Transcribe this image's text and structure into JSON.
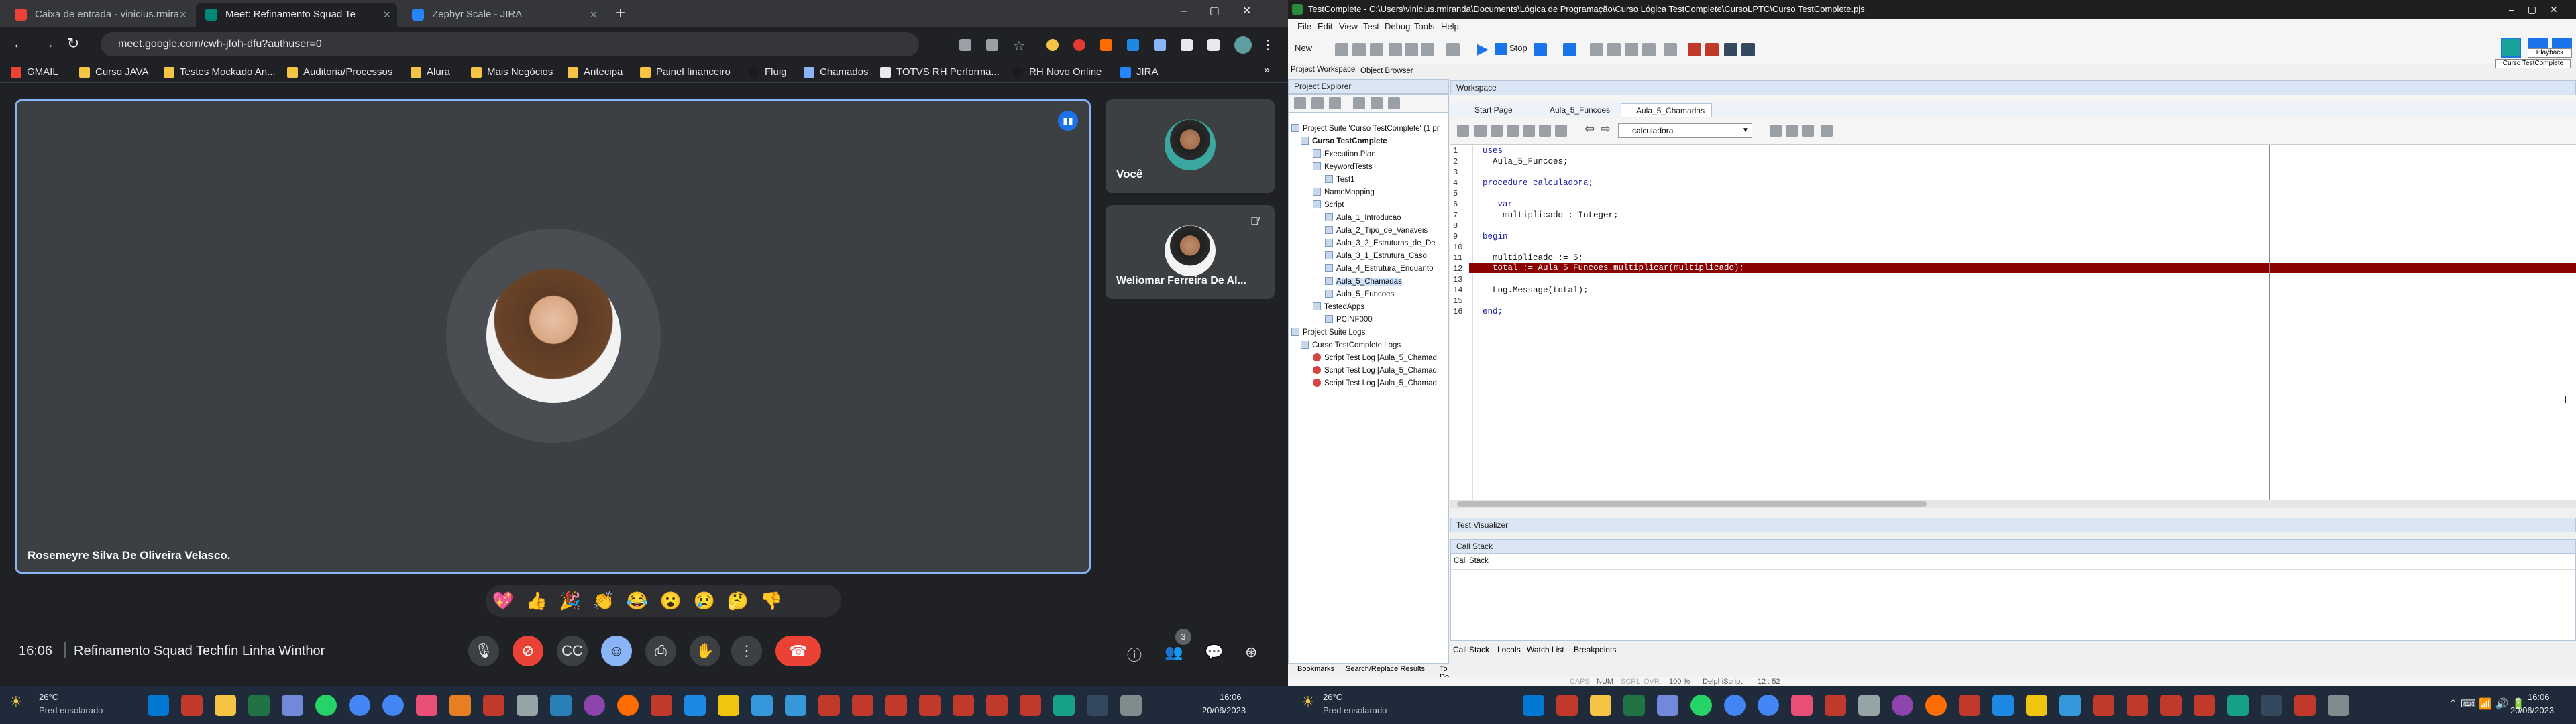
{
  "browser": {
    "tabs": [
      {
        "label": "Caixa de entrada - vinicius.rmira",
        "fav_color": "#ea4335",
        "active": false
      },
      {
        "label": "Meet: Refinamento Squad Te",
        "fav_color": "#00897b",
        "active": true
      },
      {
        "label": "Zephyr Scale - JIRA",
        "fav_color": "#2684ff",
        "active": false
      }
    ],
    "url": "meet.google.com/cwh-jfoh-dfu?authuser=0",
    "bookmarks": [
      "GMAIL",
      "Curso JAVA",
      "Testes Mockado An...",
      "Auditoria/Processos",
      "Alura",
      "Mais Negócios",
      "Antecipa",
      "Painel financeiro",
      "Fluig",
      "Chamados",
      "TOTVS RH Performa...",
      "RH Novo Online",
      "JIRA"
    ]
  },
  "meet": {
    "main_participant": "Rosemeyre Silva De Oliveira Velasco.",
    "self_label": "Você",
    "other_participant": "Weliomar Ferreira De Al...",
    "time": "16:06",
    "meeting_name": "Refinamento Squad Techfin Linha Winthor",
    "participants_count": "3",
    "reactions": [
      "💖",
      "👍",
      "🎉",
      "👏",
      "😂",
      "😮",
      "😢",
      "🤔",
      "👎"
    ]
  },
  "testcomplete": {
    "title": "TestComplete - C:\\Users\\vinicius.rmiranda\\Documents\\Lógica de Programação\\Curso Lógica TestComplete\\CursoLPTC\\Curso TestComplete.pjs",
    "menu": [
      "File",
      "Edit",
      "View",
      "Test",
      "Debug",
      "Tools",
      "Help"
    ],
    "new_label": "New",
    "stop_label": "Stop",
    "playback_tip": "Playback",
    "curso_tip": "Curso TestComplete",
    "left_tabs": [
      "Project Workspace",
      "Object Browser"
    ],
    "explorer_title": "Project Explorer",
    "tree": [
      "Project Suite 'Curso TestComplete' (1 pr",
      "Curso TestComplete",
      "Execution Plan",
      "KeywordTests",
      "Test1",
      "NameMapping",
      "Script",
      "Aula_1_Introducao",
      "Aula_2_Tipo_de_Variaveis",
      "Aula_3_2_Estruturas_de_De",
      "Aula_3_1_Estrutura_Caso",
      "Aula_4_Estrutura_Enquanto",
      "Aula_5_Chamadas",
      "Aula_5_Funcoes",
      "TestedApps",
      "PCINF000",
      "Project Suite Logs",
      "Curso TestComplete Logs",
      "Script Test Log [Aula_5_Chamad",
      "Script Test Log [Aula_5_Chamad",
      "Script Test Log [Aula_5_Chamad"
    ],
    "workspace_title": "Workspace",
    "doc_tabs": [
      "Start Page",
      "Aula_5_Funcoes",
      "Aula_5_Chamadas"
    ],
    "routine": "calculadora",
    "code_lines": [
      "uses",
      "  Aula_5_Funcoes;",
      "",
      "procedure calculadora;",
      "",
      "   var",
      "    multiplicado : Integer;",
      "",
      "begin",
      "",
      "  multiplicado := 5;",
      "  total := Aula_5_Funcoes.multiplicar(multiplicado);",
      "",
      "  Log.Message(total);",
      "",
      "end;"
    ],
    "line_numbers": [
      "1",
      "2",
      "3",
      "4",
      "5",
      "6",
      "7",
      "8",
      "9",
      "10",
      "11",
      "12",
      "13",
      "14",
      "15",
      "16"
    ],
    "visualizer": "Test Visualizer",
    "call_stack_title": "Call Stack",
    "call_stack_header": "Call Stack",
    "bottom_tabs": [
      "Call Stack",
      "Locals",
      "Watch List",
      "Breakpoints"
    ],
    "left_bottom_tabs": [
      "Bookmarks",
      "Search/Replace Results",
      "To Do"
    ],
    "status": [
      "CAPS",
      "NUM",
      "SCRL",
      "OVR",
      "100 %",
      "DelphiScript",
      "12 : 52"
    ]
  },
  "taskbar": {
    "weather_temp": "26°C",
    "weather_desc": "Pred ensolarado",
    "clock_time": "16:06",
    "clock_date": "20/06/2023"
  }
}
